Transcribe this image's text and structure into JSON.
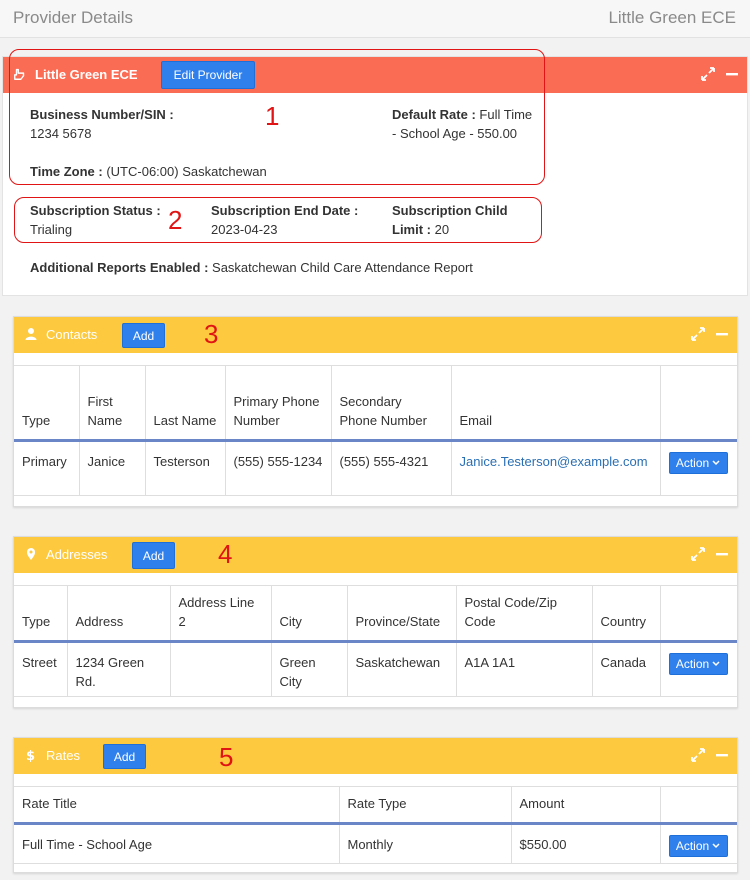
{
  "page": {
    "title": "Provider Details",
    "right_label": "Little Green ECE"
  },
  "provider": {
    "name": "Little Green ECE",
    "edit_label": "Edit Provider",
    "business_number_label": "Business Number/SIN :",
    "business_number": "1234 5678",
    "default_rate_label": "Default Rate :",
    "default_rate_line1": "Full Time",
    "default_rate_line2": "- School Age - 550.00",
    "timezone_label": "Time Zone :",
    "timezone": "(UTC-06:00) Saskatchewan",
    "sub_status_label": "Subscription Status :",
    "sub_status": "Trialing",
    "sub_end_label": "Subscription End Date :",
    "sub_end": "2023-04-23",
    "sub_limit_label_line1": "Subscription Child",
    "sub_limit_label_line2": "Limit :",
    "sub_limit": "20",
    "reports_label": "Additional Reports Enabled :",
    "reports_value": "Saskatchewan Child Care Attendance Report"
  },
  "annotations": [
    "1",
    "2",
    "3",
    "4",
    "5"
  ],
  "contacts": {
    "title": "Contacts",
    "add_label": "Add",
    "headers": [
      "Type",
      "First Name",
      "Last Name",
      "Primary Phone Number",
      "Secondary Phone Number",
      "Email"
    ],
    "rows": [
      {
        "type": "Primary",
        "first": "Janice",
        "last": "Testerson",
        "primary_phone": "(555) 555-1234",
        "secondary_phone": "(555) 555-4321",
        "email": "Janice.Testerson@example.com",
        "action": "Action"
      }
    ]
  },
  "addresses": {
    "title": "Addresses",
    "add_label": "Add",
    "headers": [
      "Type",
      "Address",
      "Address Line 2",
      "City",
      "Province/State",
      "Postal Code/Zip Code",
      "Country"
    ],
    "rows": [
      {
        "type": "Street",
        "address": "1234 Green Rd.",
        "line2": "",
        "city": "Green City",
        "province": "Saskatchewan",
        "postal": "A1A 1A1",
        "country": "Canada",
        "action": "Action"
      }
    ]
  },
  "rates": {
    "title": "Rates",
    "add_label": "Add",
    "headers": [
      "Rate Title",
      "Rate Type",
      "Amount"
    ],
    "rows": [
      {
        "title": "Full Time - School Age",
        "type": "Monthly",
        "amount": "$550.00",
        "action": "Action"
      }
    ]
  },
  "colors": {
    "provider_header": "#fb6c55",
    "section_header": "#fdc93f",
    "button": "#2f80ed",
    "annotation": "#e01414"
  },
  "icons": {
    "provider": "hand-pointing-icon",
    "contacts": "user-icon",
    "addresses": "map-marker-icon",
    "rates": "dollar-icon",
    "expand": "expand-icon",
    "collapse": "minus-icon",
    "dropdown": "chevron-down-icon"
  }
}
